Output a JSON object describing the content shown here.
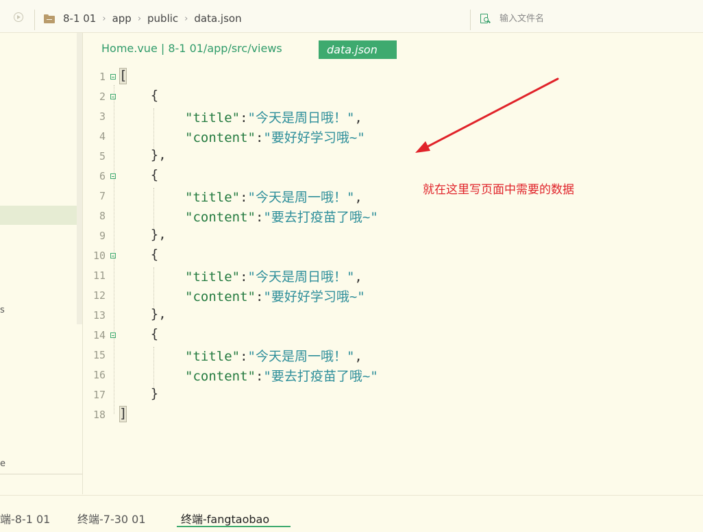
{
  "breadcrumb": {
    "items": [
      "8-1 01",
      "app",
      "public",
      "data.json"
    ]
  },
  "search": {
    "placeholder": "输入文件名"
  },
  "sidebar": {
    "fragments": [
      "s",
      "e"
    ]
  },
  "editor": {
    "tabs": [
      {
        "label": "Home.vue | 8-1 01/app/src/views",
        "active": false
      },
      {
        "label": "data.json",
        "active": true
      }
    ],
    "lines": [
      {
        "num": "1",
        "text": "["
      },
      {
        "num": "2",
        "text": "    {"
      },
      {
        "num": "3",
        "key": "\"title\"",
        "value": "\"今天是周日哦！\"",
        "tail": ","
      },
      {
        "num": "4",
        "key": "\"content\"",
        "value": "\"要好好学习哦~\"",
        "tail": ""
      },
      {
        "num": "5",
        "text": "    },"
      },
      {
        "num": "6",
        "text": "    {"
      },
      {
        "num": "7",
        "key": "\"title\"",
        "value": "\"今天是周一哦！\"",
        "tail": ","
      },
      {
        "num": "8",
        "key": "\"content\"",
        "value": "\"要去打疫苗了哦~\"",
        "tail": ""
      },
      {
        "num": "9",
        "text": "    },"
      },
      {
        "num": "10",
        "text": "    {"
      },
      {
        "num": "11",
        "key": "\"title\"",
        "value": "\"今天是周日哦！\"",
        "tail": ","
      },
      {
        "num": "12",
        "key": "\"content\"",
        "value": "\"要好好学习哦~\"",
        "tail": ""
      },
      {
        "num": "13",
        "text": "    },"
      },
      {
        "num": "14",
        "text": "    {"
      },
      {
        "num": "15",
        "key": "\"title\"",
        "value": "\"今天是周一哦！\"",
        "tail": ","
      },
      {
        "num": "16",
        "key": "\"content\"",
        "value": "\"要去打疫苗了哦~\"",
        "tail": ""
      },
      {
        "num": "17",
        "text": "    }"
      },
      {
        "num": "18",
        "text": "]"
      }
    ]
  },
  "annotation": {
    "text": "就在这里写页面中需要的数据",
    "color": "#e0232a"
  },
  "terminal": {
    "tabs": [
      {
        "label": "端-8-1 01",
        "active": false
      },
      {
        "label": "终端-7-30 01",
        "active": false
      },
      {
        "label": "终端-fangtaobao",
        "active": true
      }
    ]
  },
  "colors": {
    "accent": "#3eaa6f",
    "json_key": "#237a3f",
    "json_string": "#2d8e9a",
    "background": "#fdfbea"
  }
}
